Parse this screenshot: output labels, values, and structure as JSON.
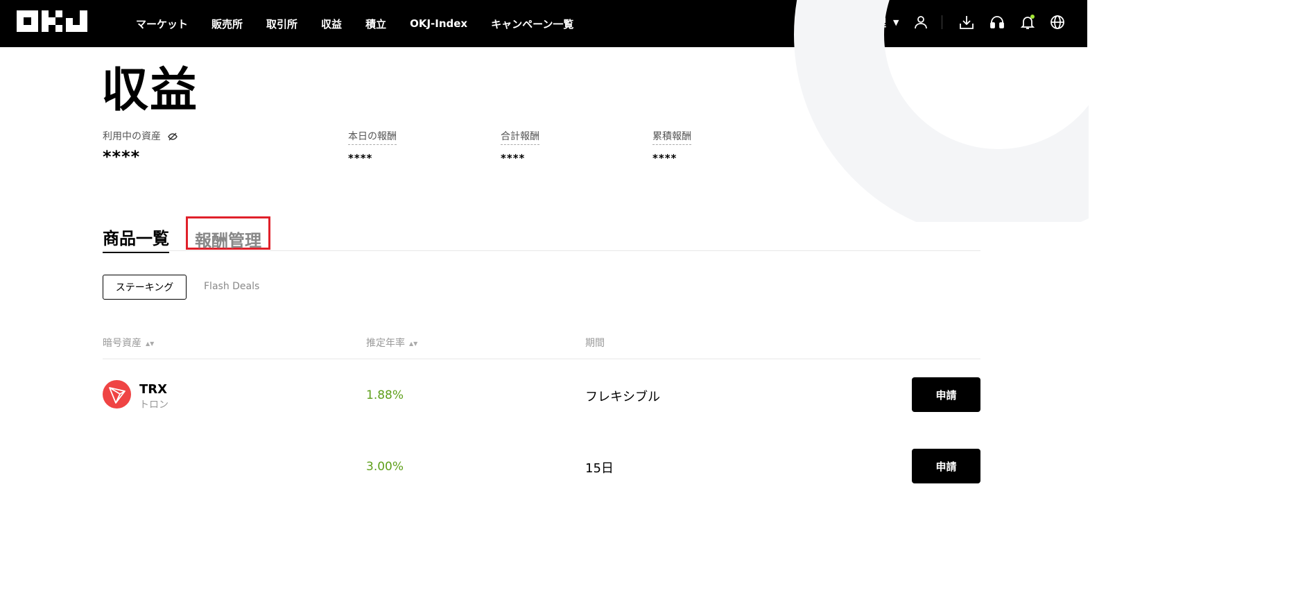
{
  "header": {
    "logo": "OKJ",
    "nav": [
      "マーケット",
      "販売所",
      "取引所",
      "収益",
      "積立",
      "OKJ-Index",
      "キャンペーン一覧"
    ],
    "asset_menu": "資産管理",
    "icons": [
      "user-icon",
      "download-icon",
      "support-headset-icon",
      "bell-icon",
      "globe-icon"
    ],
    "colors": {
      "bg": "#000000",
      "notify_dot": "#a3e635"
    }
  },
  "page": {
    "title": "収益"
  },
  "stats": {
    "assets_in_use": {
      "label": "利用中の資産",
      "value": "****"
    },
    "today_reward": {
      "label": "本日の報酬",
      "value": "****"
    },
    "total_reward": {
      "label": "合計報酬",
      "value": "****"
    },
    "cumulative_reward": {
      "label": "累積報酬",
      "value": "****"
    }
  },
  "tabs": {
    "products": "商品一覧",
    "reward_management": "報酬管理"
  },
  "subtabs": {
    "staking": "ステーキング",
    "flash_deals": "Flash Deals"
  },
  "table": {
    "headers": {
      "asset": "暗号資産",
      "apr": "推定年率",
      "term": "期間"
    },
    "rows": [
      {
        "symbol": "TRX",
        "name": "トロン",
        "apr": "1.88%",
        "term": "フレキシブル",
        "action": "申請"
      },
      {
        "symbol": "",
        "name": "",
        "apr": "3.00%",
        "term": "15日",
        "action": "申請"
      }
    ],
    "colors": {
      "apr": "#5e9f1a",
      "trx_icon": "#ef4444"
    }
  }
}
